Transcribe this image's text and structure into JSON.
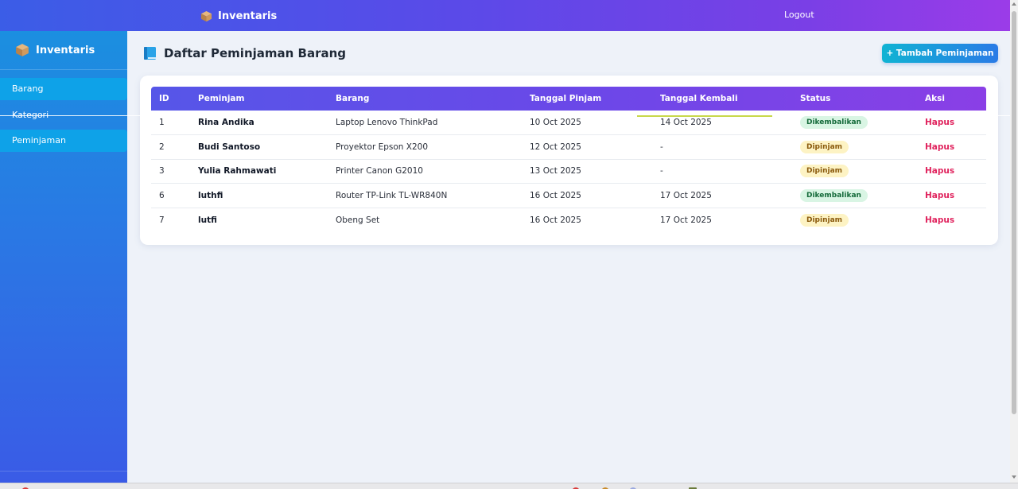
{
  "app": {
    "brand": "Inventaris",
    "logout_label": "Logout"
  },
  "sidebar": {
    "brand": "Inventaris",
    "items": [
      {
        "label": "Barang",
        "active": true
      },
      {
        "label": "Kategori",
        "active": false
      },
      {
        "label": "Peminjaman",
        "active": true
      }
    ]
  },
  "page": {
    "title": "Daftar Peminjaman Barang",
    "add_button": "+ Tambah Peminjaman"
  },
  "table": {
    "headers": [
      "ID",
      "Peminjam",
      "Barang",
      "Tanggal Pinjam",
      "Tanggal Kembali",
      "Status",
      "Aksi"
    ],
    "rows": [
      {
        "id": "1",
        "borrower": "Rina Andika",
        "item": "Laptop Lenovo ThinkPad",
        "borrow_date": "10 Oct 2025",
        "return_date": "14 Oct 2025",
        "status": "Dikembalikan",
        "status_type": "returned",
        "action": "Hapus"
      },
      {
        "id": "2",
        "borrower": "Budi Santoso",
        "item": "Proyektor Epson X200",
        "borrow_date": "12 Oct 2025",
        "return_date": "-",
        "status": "Dipinjam",
        "status_type": "borrowed",
        "action": "Hapus"
      },
      {
        "id": "3",
        "borrower": "Yulia Rahmawati",
        "item": "Printer Canon G2010",
        "borrow_date": "13 Oct 2025",
        "return_date": "-",
        "status": "Dipinjam",
        "status_type": "borrowed",
        "action": "Hapus"
      },
      {
        "id": "6",
        "borrower": "luthfi",
        "item": "Router TP-Link TL-WR840N",
        "borrow_date": "16 Oct 2025",
        "return_date": "17 Oct 2025",
        "status": "Dikembalikan",
        "status_type": "returned",
        "action": "Hapus"
      },
      {
        "id": "7",
        "borrower": "lutfi",
        "item": "Obeng Set",
        "borrow_date": "16 Oct 2025",
        "return_date": "17 Oct 2025",
        "status": "Dipinjam",
        "status_type": "borrowed",
        "action": "Hapus"
      }
    ]
  },
  "colors": {
    "accent_purple": "#6a48e8",
    "accent_blue": "#1b8fe0",
    "danger": "#e0245e",
    "returned_bg": "#d9f5e4",
    "borrowed_bg": "#fdf3c4"
  },
  "icons": {
    "brand": "package-box-icon",
    "title": "book-icon"
  }
}
